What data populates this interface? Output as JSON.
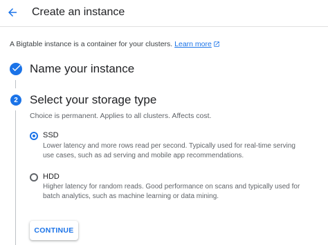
{
  "header": {
    "title": "Create an instance",
    "back_icon": "arrow-back-icon"
  },
  "intro": {
    "text": "A Bigtable instance is a container for your clusters.",
    "link_label": "Learn more",
    "link_icon": "open-in-new-icon"
  },
  "steps": [
    {
      "title": "Name your instance",
      "status": "completed",
      "icon": "check-circle-icon"
    },
    {
      "number": "2",
      "title": "Select your storage type",
      "status": "active",
      "description": "Choice is permanent. Applies to all clusters. Affects cost."
    }
  ],
  "storage_options": [
    {
      "label": "SSD",
      "selected": true,
      "desc_line1": "Lower latency and more rows read per second. Typically used for real-time serving",
      "desc_line2": "use cases, such as ad serving and mobile app recommendations."
    },
    {
      "label": "HDD",
      "selected": false,
      "desc_line1": "Higher latency for random reads. Good performance on scans and typically used for",
      "desc_line2": "batch analytics, such as machine learning or data mining."
    }
  ],
  "actions": {
    "continue_label": "CONTINUE"
  },
  "colors": {
    "accent": "#1a73e8",
    "text_primary": "#202124",
    "text_secondary": "#5f6368",
    "divider": "#e0e0e0"
  }
}
